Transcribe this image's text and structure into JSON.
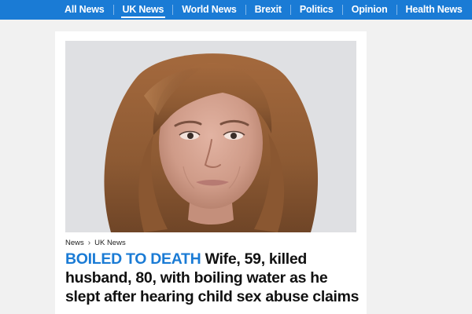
{
  "nav": {
    "items": [
      {
        "label": "All News"
      },
      {
        "label": "UK News"
      },
      {
        "label": "World News"
      },
      {
        "label": "Brexit"
      },
      {
        "label": "Politics"
      },
      {
        "label": "Opinion"
      },
      {
        "label": "Health News"
      }
    ],
    "active": "UK News"
  },
  "breadcrumb": {
    "items": [
      {
        "label": "News"
      },
      {
        "label": "UK News"
      }
    ],
    "separator": "›"
  },
  "article": {
    "kicker": "BOILED TO DEATH",
    "headline": "Wife, 59, killed husband, 80, with boiling water as he slept after hearing child sex abuse claims",
    "image_subject": "portrait photo of a woman with long brown hair"
  },
  "colors": {
    "brand": "#1a7bd5",
    "page_bg": "#f1f1f1",
    "text": "#111111"
  }
}
